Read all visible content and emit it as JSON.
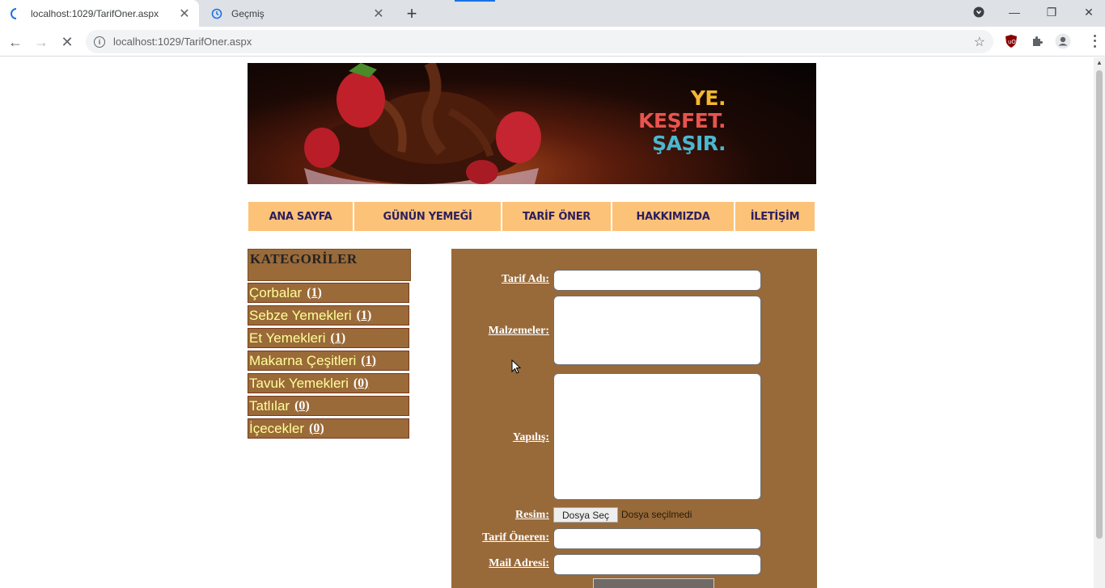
{
  "browser": {
    "tabs": [
      {
        "title": "localhost:1029/TarifOner.aspx",
        "active": true
      },
      {
        "title": "Geçmiş",
        "active": false
      }
    ],
    "url": "localhost:1029/TarifOner.aspx"
  },
  "banner": {
    "slogan": [
      "YE.",
      "KEŞFET.",
      "ŞAŞIR."
    ]
  },
  "menu": [
    {
      "label": "ANA SAYFA"
    },
    {
      "label": "GÜNÜN YEMEĞİ"
    },
    {
      "label": "TARİF ÖNER"
    },
    {
      "label": "HAKKIMIZDA"
    },
    {
      "label": "İLETİŞİM"
    }
  ],
  "categories": {
    "title": "KATEGORİLER",
    "items": [
      {
        "label": "Çorbalar",
        "count": "(1)"
      },
      {
        "label": "Sebze Yemekleri",
        "count": "(1)"
      },
      {
        "label": "Et Yemekleri",
        "count": "(1)"
      },
      {
        "label": "Makarna Çeşitleri",
        "count": "(1)"
      },
      {
        "label": "Tavuk Yemekleri",
        "count": "(0)"
      },
      {
        "label": "Tatlılar",
        "count": "(0)"
      },
      {
        "label": "İçecekler",
        "count": "(0)"
      }
    ]
  },
  "form": {
    "recipe_name_label": "Tarif Adı:",
    "ingredients_label": "Malzemeler:",
    "preparation_label": "Yapılış:",
    "image_label": "Resim:",
    "file_button": "Dosya Seç",
    "file_status": "Dosya seçilmedi",
    "suggester_label": "Tarif Öneren:",
    "email_label": "Mail Adresi:"
  },
  "colors": {
    "menu_bg": "#fcc278",
    "panel_bg": "#986a3a",
    "category_text": "#ffff99"
  }
}
